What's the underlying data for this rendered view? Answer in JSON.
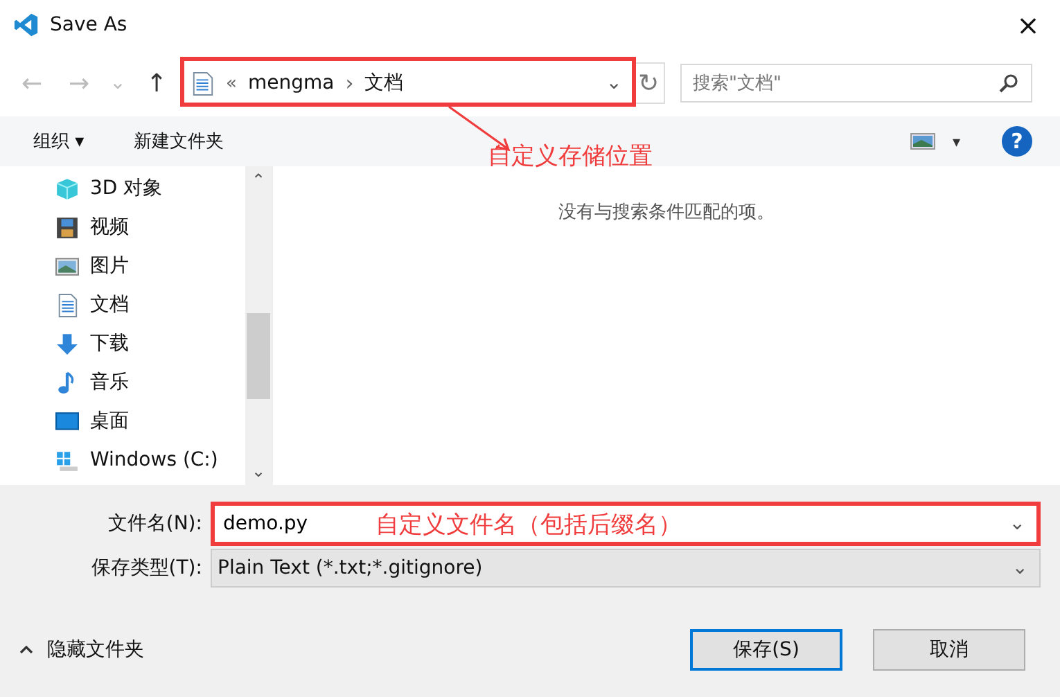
{
  "window": {
    "title": "Save As",
    "close": "×"
  },
  "nav": {
    "back": "←",
    "forward": "→",
    "recent": "⌄",
    "up": "↑"
  },
  "address": {
    "annotation": "自定义存储位置",
    "prefix": "«",
    "path": [
      {
        "label": "mengma"
      },
      {
        "label": "文档"
      }
    ],
    "separator": "›",
    "dropdown": "⌄",
    "refresh": "↻"
  },
  "search": {
    "placeholder": "搜索\"文档\""
  },
  "toolbar": {
    "organize": "组织 ▾",
    "new_folder": "新建文件夹",
    "view_caret": "▾",
    "help": "?"
  },
  "sidebar": {
    "items": [
      {
        "label": "3D 对象",
        "kind": "cube"
      },
      {
        "label": "视频",
        "kind": "film"
      },
      {
        "label": "图片",
        "kind": "image"
      },
      {
        "label": "文档",
        "kind": "doc"
      },
      {
        "label": "下载",
        "kind": "download"
      },
      {
        "label": "音乐",
        "kind": "music"
      },
      {
        "label": "桌面",
        "kind": "desktop"
      },
      {
        "label": "Windows (C:)",
        "kind": "drive"
      }
    ],
    "scroll_up": "⌃",
    "scroll_down": "⌄"
  },
  "empty_message": "没有与搜索条件匹配的项。",
  "form": {
    "filename_label": "文件名(N):",
    "filename": "demo.py",
    "filename_annotation": "自定义文件名（包括后缀名）",
    "type_label": "保存类型(T):",
    "type": "Plain Text (*.txt;*.gitignore)",
    "caret": "⌄"
  },
  "footer": {
    "hide_folders": "隐藏文件夹",
    "save": "保存(S)",
    "cancel": "取消"
  }
}
